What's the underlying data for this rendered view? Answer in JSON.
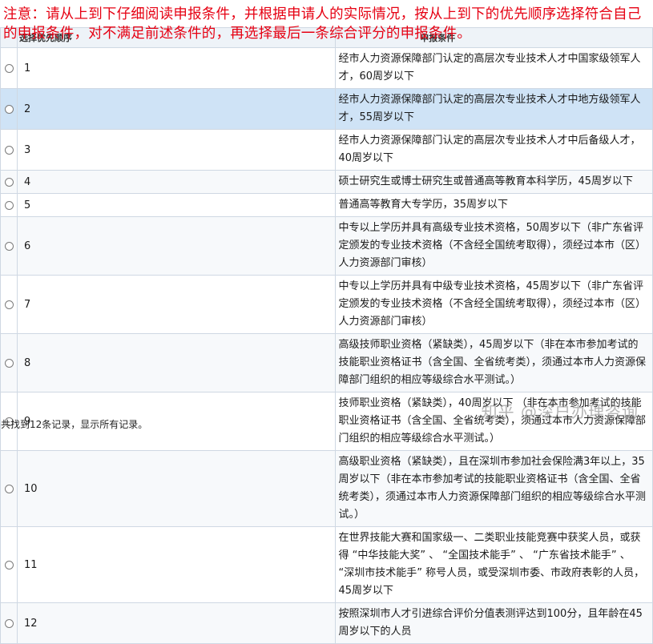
{
  "notice": "注意：请从上到下仔细阅读申报条件，并根据申请人的实际情况，按从上到下的优先顺序选择符合自己的申报条件，对不满足前述条件的，再选择最后一条综合评分的申报条件。",
  "table": {
    "headers": {
      "order": "选择优先顺序",
      "condition": "申报条件"
    },
    "selected_row": 2,
    "rows": [
      {
        "num": "1",
        "text": "经市人力资源保障部门认定的高层次专业技术人才中国家级领军人才，60周岁以下"
      },
      {
        "num": "2",
        "text": "经市人力资源保障部门认定的高层次专业技术人才中地方级领军人才，55周岁以下"
      },
      {
        "num": "3",
        "text": "经市人力资源保障部门认定的高层次专业技术人才中后备级人才，40周岁以下"
      },
      {
        "num": "4",
        "text": "硕士研究生或博士研究生或普通高等教育本科学历，45周岁以下"
      },
      {
        "num": "5",
        "text": "普通高等教育大专学历，35周岁以下"
      },
      {
        "num": "6",
        "text": "中专以上学历并具有高级专业技术资格，50周岁以下（非广东省评定颁发的专业技术资格（不含经全国统考取得），须经过本市（区）人力资源部门审核）"
      },
      {
        "num": "7",
        "text": "中专以上学历并具有中级专业技术资格，45周岁以下（非广东省评定颁发的专业技术资格（不含经全国统考取得），须经过本市（区）人力资源部门审核）"
      },
      {
        "num": "8",
        "text": "高级技师职业资格（紧缺类），45周岁以下（非在本市参加考试的技能职业资格证书（含全国、全省统考类），须通过本市人力资源保障部门组织的相应等级综合水平测试。）"
      },
      {
        "num": "9",
        "text": "技师职业资格（紧缺类），40周岁以下 （非在本市参加考试的技能职业资格证书（含全国、全省统考类），须通过本市人力资源保障部门组织的相应等级综合水平测试。）"
      },
      {
        "num": "10",
        "text": "高级职业资格（紧缺类），且在深圳市参加社会保险满3年以上，35周岁以下（非在本市参加考试的技能职业资格证书（含全国、全省统考类），须通过本市人力资源保障部门组织的相应等级综合水平测试。）"
      },
      {
        "num": "11",
        "text": "在世界技能大赛和国家级一、二类职业技能竞赛中获奖人员，或获得 “中华技能大奖” 、 “全国技术能手” 、 “广东省技术能手” 、 “深圳市技术能手” 称号人员，或受深圳市委、市政府表彰的人员，45周岁以下"
      },
      {
        "num": "12",
        "text": "按照深圳市人才引进综合评价分值表测评达到100分，且年龄在45周岁以下的人员"
      }
    ]
  },
  "footer": "共找到12条记录，显示所有记录。",
  "watermark": "知乎 @深户办理咨询"
}
